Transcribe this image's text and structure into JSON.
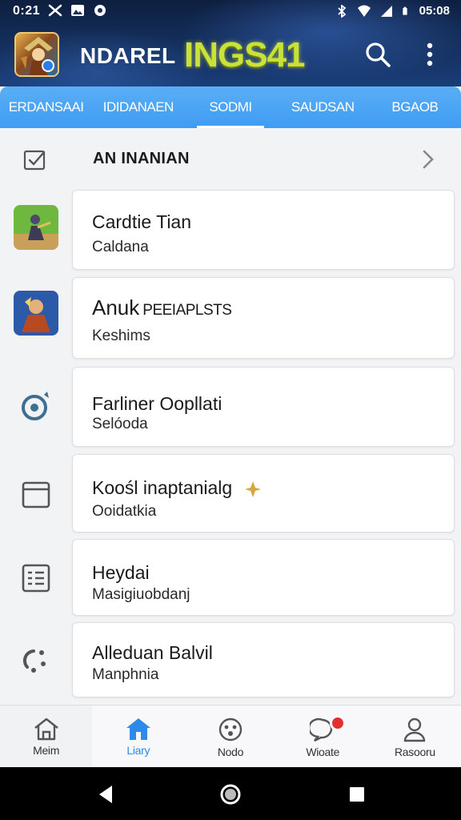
{
  "status_bar": {
    "time": "0:21",
    "clock": "05:08"
  },
  "app_bar": {
    "title": "NDAREL",
    "brand": "INGS41"
  },
  "tabs": [
    {
      "label": "ERDANSAAI",
      "active": false
    },
    {
      "label": "IDIDANAEN",
      "active": false
    },
    {
      "label": "SODMI",
      "active": true
    },
    {
      "label": "SAUDSAN",
      "active": false
    },
    {
      "label": "BGAOB",
      "active": false
    }
  ],
  "section": {
    "title": "AN INANIAN"
  },
  "list": [
    {
      "title": "Cardtie Tian",
      "subtitle": "Caldana",
      "icon": "game-icon-green"
    },
    {
      "title": "Anuk",
      "title_extra": "PEEIAPLSTS",
      "subtitle": "Keshims",
      "icon": "game-icon-blue"
    },
    {
      "title": "Farliner Oopllati",
      "subtitle": "Selóoda",
      "icon": "target-icon"
    },
    {
      "title": "Koośl inaptanialg",
      "subtitle": "Ooidatkia",
      "icon": "window-icon"
    },
    {
      "title": "Heydai",
      "subtitle": "Masigiuobdanj",
      "icon": "list-icon"
    },
    {
      "title": "Alleduan Balvil",
      "subtitle": "Manphnia",
      "icon": "loader-icon"
    }
  ],
  "bottom_nav": [
    {
      "label": "Meim",
      "icon": "home-outline-icon",
      "active": false
    },
    {
      "label": "Liary",
      "icon": "home-filled-icon",
      "active": true
    },
    {
      "label": "Nodo",
      "icon": "face-icon",
      "active": false
    },
    {
      "label": "Wioate",
      "icon": "chat-icon",
      "active": false,
      "badge": true
    },
    {
      "label": "Rasooru",
      "icon": "person-icon",
      "active": false
    }
  ],
  "colors": {
    "tab_bar": "#3f9cf2",
    "active_nav": "#2d8ae8",
    "header_dark": "#14305e",
    "brand": "#c9e23a",
    "badge_red": "#e23030"
  }
}
